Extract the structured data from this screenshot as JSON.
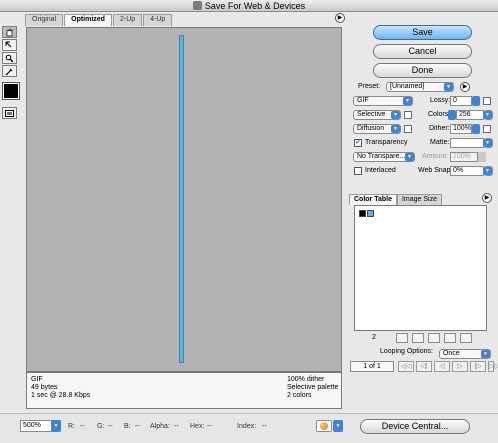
{
  "window": {
    "title": "Save For Web & Devices"
  },
  "tabs": [
    "Original",
    "Optimized",
    "2-Up",
    "4-Up"
  ],
  "info": {
    "left": [
      "GIF",
      "49 bytes",
      "1 sec @ 28.8 Kbps"
    ],
    "right": [
      "100% dither",
      "Selective palette",
      "2 colors"
    ]
  },
  "buttons": {
    "save": "Save",
    "cancel": "Cancel",
    "done": "Done"
  },
  "settings": {
    "preset_label": "Preset:",
    "preset_value": "[Unnamed]",
    "format": "GIF",
    "lossy_label": "Lossy:",
    "lossy_value": "0",
    "reduction": "Selective",
    "colors_label": "Colors:",
    "colors_value": "256",
    "dither_algo": "Diffusion",
    "dither_label": "Dither:",
    "dither_value": "100%",
    "transparency_label": "Transparency",
    "transparency_checked": true,
    "matte_label": "Matte:",
    "transparency_dither": "No Transpare...",
    "amount_label": "Amount:",
    "amount_value": "100%",
    "interlaced_label": "Interlaced",
    "interlaced_checked": false,
    "websnap_label": "Web Snap:",
    "websnap_value": "0%"
  },
  "color_table": {
    "tabs": [
      "Color Table",
      "Image Size"
    ],
    "count": "2",
    "colors": [
      "#000000",
      "#55b5e2"
    ]
  },
  "animation": {
    "looping_label": "Looping Options:",
    "looping_value": "Once",
    "frame": "1 of 1",
    "controls": [
      "◁◁",
      "◁|",
      "◁",
      "▷",
      "|▷",
      "▷▷"
    ]
  },
  "bottom": {
    "zoom": "500%",
    "readouts": [
      "R:",
      "--",
      "G:",
      "--",
      "B:",
      "--",
      "Alpha:",
      "--",
      "Hex:",
      "--",
      "Index:",
      "--"
    ],
    "device_central": "Device Central..."
  }
}
